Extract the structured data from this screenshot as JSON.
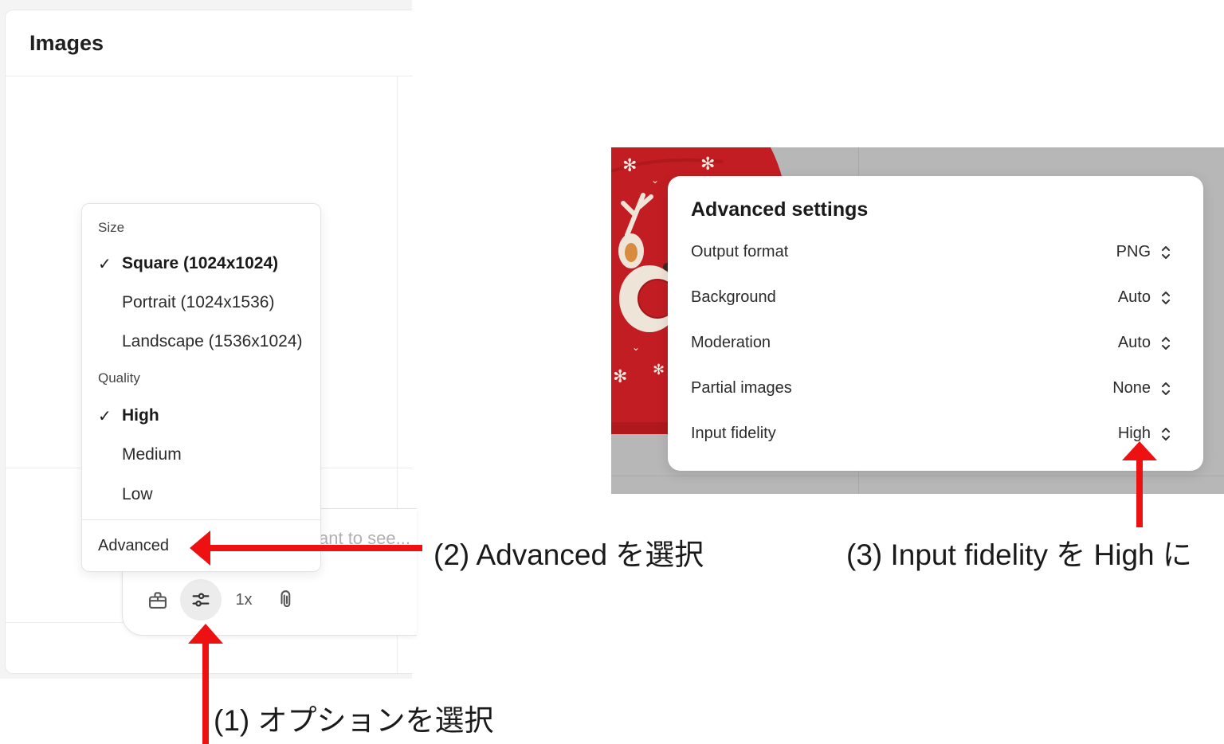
{
  "left_panel": {
    "title": "Images",
    "composer_placeholder": "ant to see...",
    "toolbar": {
      "icons": [
        "gift-icon",
        "sliders-icon",
        "paperclip-icon"
      ],
      "count_label": "1x"
    }
  },
  "options_menu": {
    "size_section": "Size",
    "size_options": [
      "Square (1024x1024)",
      "Portrait (1024x1536)",
      "Landscape (1536x1024)"
    ],
    "size_selected": "Square (1024x1024)",
    "quality_section": "Quality",
    "quality_options": [
      "High",
      "Medium",
      "Low"
    ],
    "quality_selected": "High",
    "advanced_label": "Advanced"
  },
  "advanced_settings": {
    "title": "Advanced settings",
    "rows": [
      {
        "label": "Output format",
        "value": "PNG"
      },
      {
        "label": "Background",
        "value": "Auto"
      },
      {
        "label": "Moderation",
        "value": "Auto"
      },
      {
        "label": "Partial images",
        "value": "None"
      },
      {
        "label": "Input fidelity",
        "value": "High"
      }
    ]
  },
  "annotations": {
    "step1": "(1) オプションを選択",
    "step2": "(2) Advanced を選択",
    "step3": "(3) Input fidelity を High に"
  },
  "colors": {
    "arrow": "#ee1111",
    "sweater": "#c21d22",
    "text_primary": "#1f1f1f"
  }
}
